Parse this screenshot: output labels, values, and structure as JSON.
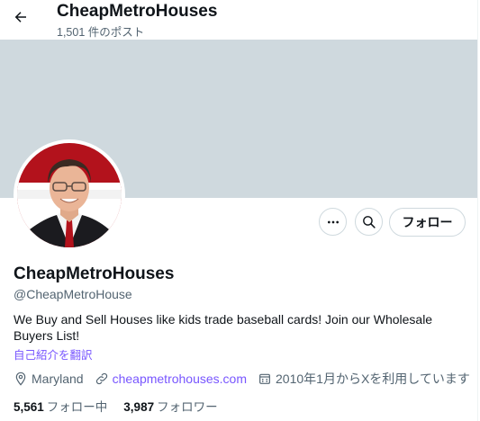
{
  "header": {
    "title": "CheapMetroHouses",
    "post_count": "1,501 件のポスト",
    "back_icon": "arrow-left-icon"
  },
  "profile": {
    "display_name": "CheapMetroHouses",
    "handle": "@CheapMetroHouse",
    "bio": "We Buy and Sell Houses like kids trade baseball cards! Join our Wholesale Buyers List!",
    "translate_link": "自己紹介を翻訳",
    "location": "Maryland",
    "website": "cheapmetrohouses.com",
    "joined": "2010年1月からXを利用しています"
  },
  "actions": {
    "more_icon": "more-dots-icon",
    "search_icon": "search-icon",
    "follow_label": "フォロー"
  },
  "stats": {
    "following_count": "5,561",
    "following_label": "フォロー中",
    "followers_count": "3,987",
    "followers_label": "フォロワー"
  },
  "colors": {
    "banner": "#cfd9de",
    "link": "#7856ff",
    "secondary_text": "#536471",
    "primary_text": "#0f1419"
  }
}
